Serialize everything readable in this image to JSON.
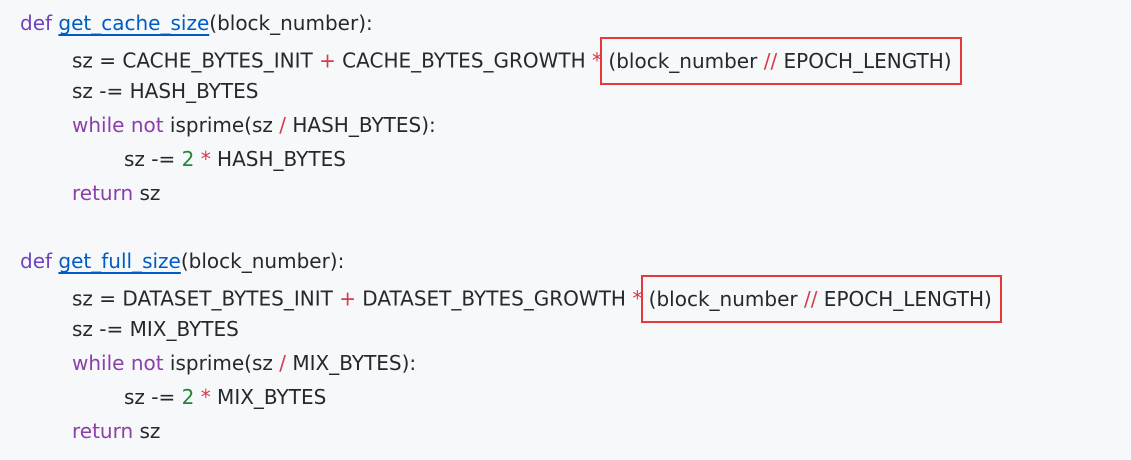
{
  "code": {
    "f1": {
      "def_kw": "def",
      "name": "get_cache_size",
      "params": "(block_number):",
      "l2_lhs": "sz = CACHE_BYTES_INIT ",
      "l2_plus": "+",
      "l2_mid": " CACHE_BYTES_GROWTH ",
      "l2_star": "*",
      "l2_hl_a": "(block_number ",
      "l2_hl_op": "//",
      "l2_hl_b": " EPOCH_LENGTH)",
      "l3": "sz -= HASH_BYTES",
      "l4_while": "while",
      "l4_not": "not",
      "l4_a": " isprime(sz ",
      "l4_div": "/",
      "l4_b": " HASH_BYTES):",
      "l5_a": "sz -= ",
      "l5_num": "2",
      "l5_star": "*",
      "l5_b": " HASH_BYTES",
      "l6_return": "return",
      "l6_b": " sz"
    },
    "f2": {
      "def_kw": "def",
      "name": "get_full_size",
      "params": "(block_number):",
      "l2_lhs": "sz = DATASET_BYTES_INIT ",
      "l2_plus": "+",
      "l2_mid": " DATASET_BYTES_GROWTH ",
      "l2_star": "*",
      "l2_hl_a": "(block_number ",
      "l2_hl_op": "//",
      "l2_hl_b": " EPOCH_LENGTH)",
      "l3": "sz -= MIX_BYTES",
      "l4_while": "while",
      "l4_not": "not",
      "l4_a": " isprime(sz ",
      "l4_div": "/",
      "l4_b": " MIX_BYTES):",
      "l5_a": "sz -= ",
      "l5_num": "2",
      "l5_star": "*",
      "l5_b": " MIX_BYTES",
      "l6_return": "return",
      "l6_b": " sz"
    }
  },
  "colors": {
    "highlight_box": "#e5383b",
    "keyword": "#6f42c1",
    "function_name": "#005cc5",
    "operator": "#d73a49",
    "number": "#22863a"
  }
}
